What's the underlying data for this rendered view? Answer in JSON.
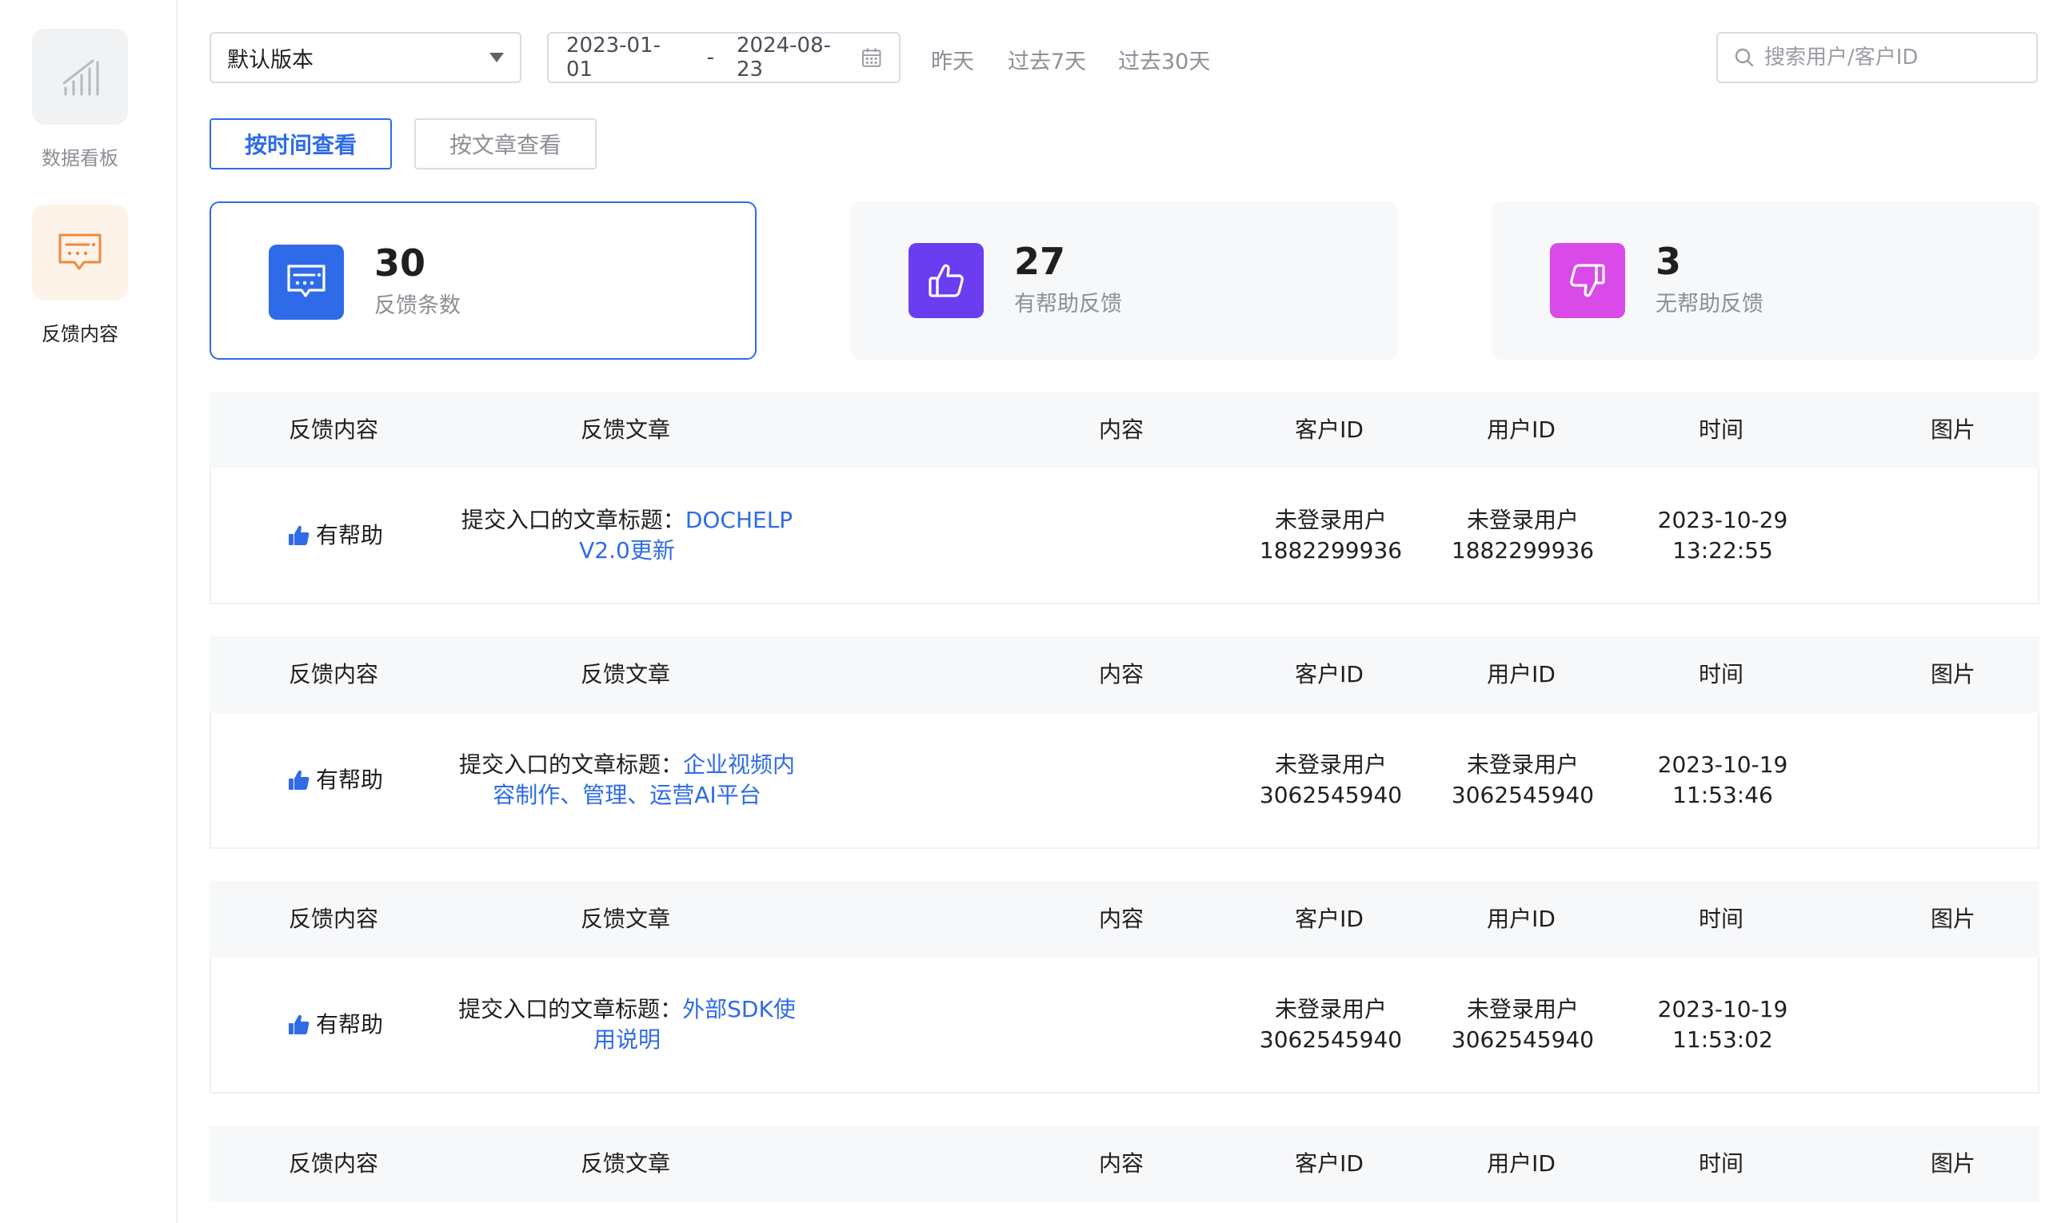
{
  "sidebar": {
    "items": [
      {
        "label": "数据看板",
        "icon": "bar-chart-icon",
        "active": false
      },
      {
        "label": "反馈内容",
        "icon": "message-icon",
        "active": true
      }
    ]
  },
  "toolbar": {
    "version_select": "默认版本",
    "date_start": "2023-01-01",
    "date_separator": "-",
    "date_end": "2024-08-23",
    "quick_ranges": [
      "昨天",
      "过去7天",
      "过去30天"
    ],
    "search_placeholder": "搜索用户/客户ID"
  },
  "tabs": [
    {
      "label": "按时间查看",
      "active": true
    },
    {
      "label": "按文章查看",
      "active": false
    }
  ],
  "stats": [
    {
      "value": "30",
      "label": "反馈条数",
      "color": "#2f6be8",
      "icon": "message-icon"
    },
    {
      "value": "27",
      "label": "有帮助反馈",
      "color": "#6a3df0",
      "icon": "thumbs-up-icon"
    },
    {
      "value": "3",
      "label": "无帮助反馈",
      "color": "#d94ae8",
      "icon": "thumbs-down-icon"
    }
  ],
  "table_headers": [
    "反馈内容",
    "反馈文章",
    "内容",
    "客户ID",
    "用户ID",
    "时间",
    "图片"
  ],
  "records": [
    {
      "feedback": "有帮助",
      "article_prefix": "提交入口的文章标题：",
      "article_title": "DOCHELP V2.0更新",
      "content": "",
      "customer_label": "未登录用户",
      "customer_id": "1882299936",
      "user_label": "未登录用户",
      "user_id": "1882299936",
      "date": "2023-10-29",
      "time": "13:22:55"
    },
    {
      "feedback": "有帮助",
      "article_prefix": "提交入口的文章标题：",
      "article_title": "企业视频内容制作、管理、运营AI平台",
      "content": "",
      "customer_label": "未登录用户",
      "customer_id": "3062545940",
      "user_label": "未登录用户",
      "user_id": "3062545940",
      "date": "2023-10-19",
      "time": "11:53:46"
    },
    {
      "feedback": "有帮助",
      "article_prefix": "提交入口的文章标题：",
      "article_title": "外部SDK使用说明",
      "content": "",
      "customer_label": "未登录用户",
      "customer_id": "3062545940",
      "user_label": "未登录用户",
      "user_id": "3062545940",
      "date": "2023-10-19",
      "time": "11:53:02"
    }
  ]
}
